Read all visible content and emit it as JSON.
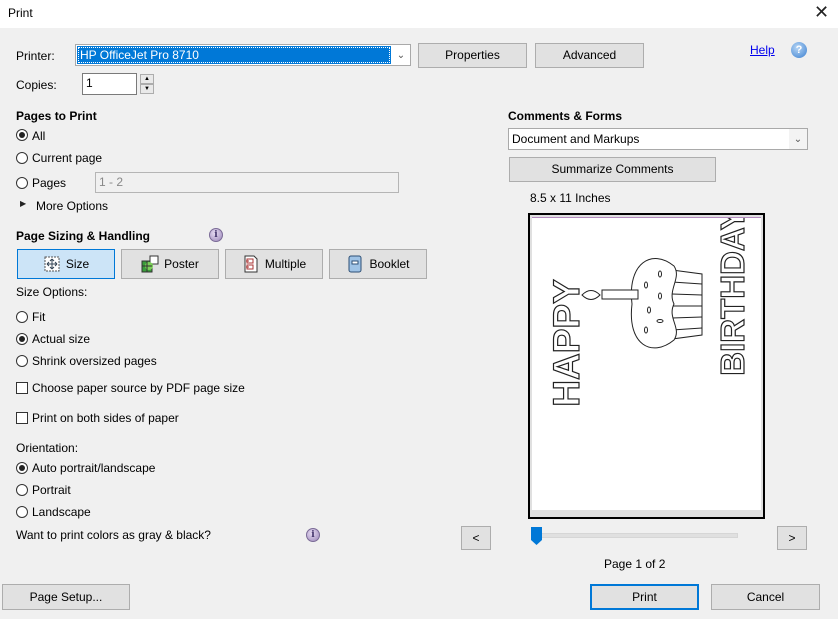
{
  "window": {
    "title": "Print",
    "close_icon": "close-icon"
  },
  "printer": {
    "label": "Printer:",
    "selected": "HP OfficeJet Pro 8710",
    "properties_label": "Properties",
    "advanced_label": "Advanced"
  },
  "help": {
    "label": "Help",
    "icon": "?"
  },
  "copies": {
    "label": "Copies:",
    "value": "1"
  },
  "pages_to_print": {
    "heading": "Pages to Print",
    "options": [
      {
        "label": "All",
        "selected": true
      },
      {
        "label": "Current page",
        "selected": false
      },
      {
        "label": "Pages",
        "selected": false
      }
    ],
    "pages_range_value": "1 - 2",
    "more_options_label": "More Options"
  },
  "page_sizing": {
    "heading": "Page Sizing & Handling",
    "info_icon": "i",
    "tabs": [
      {
        "label": "Size",
        "active": true
      },
      {
        "label": "Poster",
        "active": false
      },
      {
        "label": "Multiple",
        "active": false
      },
      {
        "label": "Booklet",
        "active": false
      }
    ],
    "size_options_label": "Size Options:",
    "size_options": [
      {
        "label": "Fit",
        "selected": false
      },
      {
        "label": "Actual size",
        "selected": true
      },
      {
        "label": "Shrink oversized pages",
        "selected": false
      }
    ],
    "choose_paper_source_label": "Choose paper source by PDF page size",
    "choose_paper_source_checked": false,
    "both_sides_label": "Print on both sides of paper",
    "both_sides_checked": false
  },
  "orientation": {
    "label": "Orientation:",
    "options": [
      {
        "label": "Auto portrait/landscape",
        "selected": true
      },
      {
        "label": "Portrait",
        "selected": false
      },
      {
        "label": "Landscape",
        "selected": false
      }
    ]
  },
  "grayscale": {
    "label": "Want to print colors as gray & black?",
    "info_icon": "i"
  },
  "comments_forms": {
    "heading": "Comments & Forms",
    "selected": "Document and Markups",
    "summarize_label": "Summarize Comments"
  },
  "preview": {
    "paper_size": "8.5 x 11 Inches",
    "prev_label": "<",
    "next_label": ">",
    "page_indicator": "Page 1 of 2",
    "current_page": 1,
    "total_pages": 2,
    "text_left": "HAPPY",
    "text_right": "BIRTHDAY"
  },
  "footer": {
    "page_setup_label": "Page Setup...",
    "print_label": "Print",
    "cancel_label": "Cancel"
  },
  "colors": {
    "accent": "#0078d7",
    "active_tab": "#cce4f7",
    "button": "#e1e1e1",
    "link": "#0000ee"
  }
}
